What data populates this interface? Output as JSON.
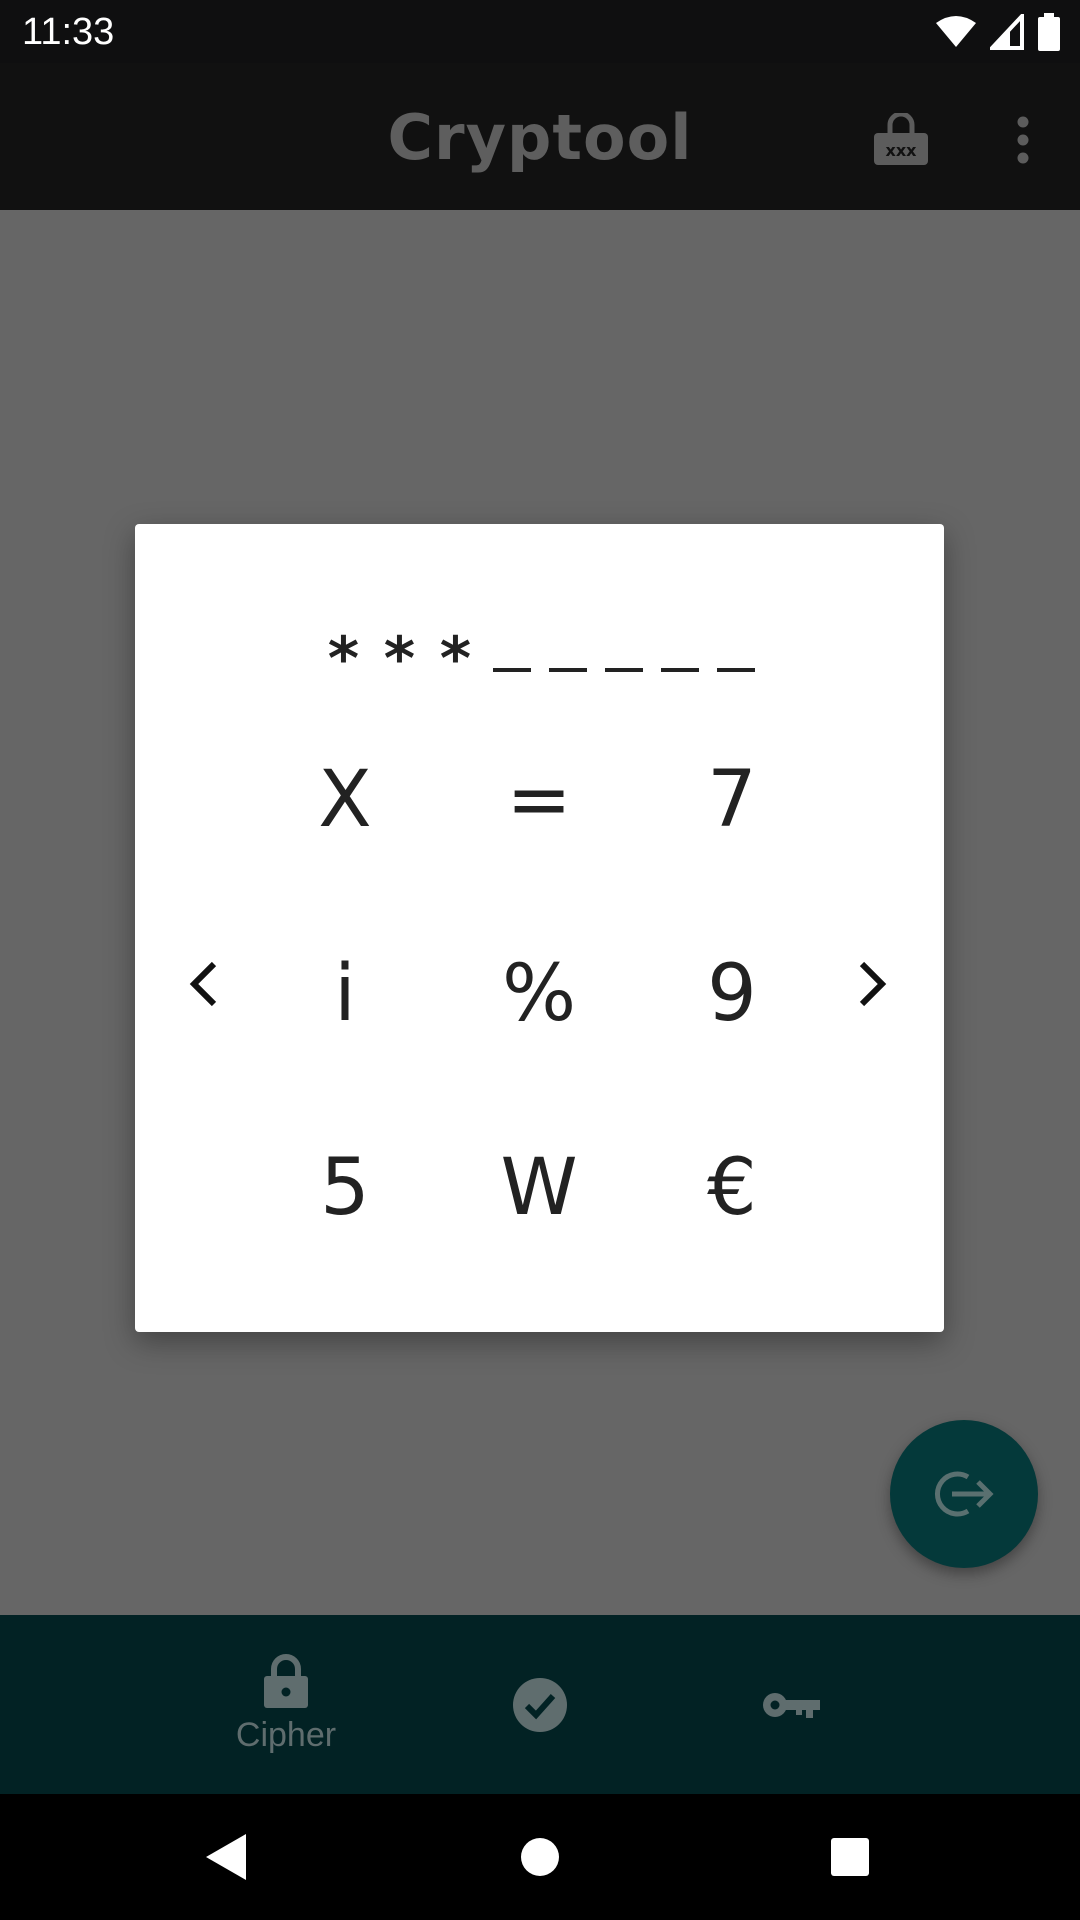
{
  "status_bar": {
    "time": "11:33"
  },
  "app_bar": {
    "title": "Cryptool"
  },
  "dialog": {
    "pin_entered": [
      "*",
      "*",
      "*"
    ],
    "pin_remaining_slots": 5,
    "keys": [
      [
        "X",
        "=",
        "7"
      ],
      [
        "i",
        "%",
        "9"
      ],
      [
        "5",
        "W",
        "€"
      ]
    ]
  },
  "bottom_nav": {
    "items": [
      {
        "label": "Cipher",
        "icon": "lock-icon"
      },
      {
        "label": "",
        "icon": "check-circle-icon"
      },
      {
        "label": "",
        "icon": "key-icon"
      }
    ]
  }
}
